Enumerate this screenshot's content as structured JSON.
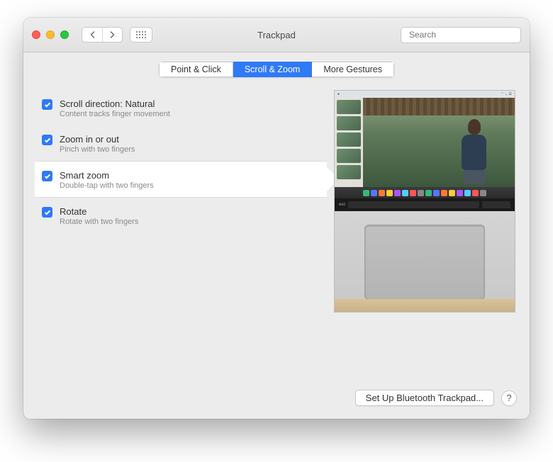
{
  "window": {
    "title": "Trackpad"
  },
  "search": {
    "placeholder": "Search"
  },
  "tabs": {
    "point_click": "Point & Click",
    "scroll_zoom": "Scroll & Zoom",
    "more_gestures": "More Gestures"
  },
  "options": [
    {
      "label": "Scroll direction: Natural",
      "desc": "Content tracks finger movement",
      "checked": true,
      "selected": false
    },
    {
      "label": "Zoom in or out",
      "desc": "Pinch with two fingers",
      "checked": true,
      "selected": false
    },
    {
      "label": "Smart zoom",
      "desc": "Double-tap with two fingers",
      "checked": true,
      "selected": true
    },
    {
      "label": "Rotate",
      "desc": "Rotate with two fingers",
      "checked": true,
      "selected": false
    }
  ],
  "footer": {
    "bluetooth": "Set Up Bluetooth Trackpad...",
    "help": "?"
  }
}
